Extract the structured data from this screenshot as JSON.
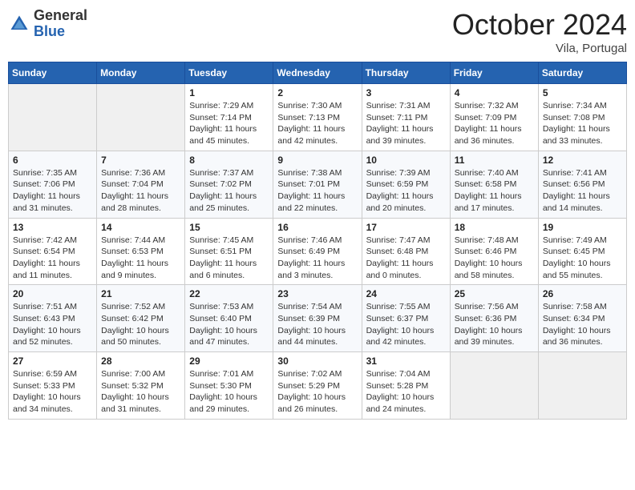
{
  "header": {
    "logo": {
      "general": "General",
      "blue": "Blue"
    },
    "title": "October 2024",
    "location": "Vila, Portugal"
  },
  "weekdays": [
    "Sunday",
    "Monday",
    "Tuesday",
    "Wednesday",
    "Thursday",
    "Friday",
    "Saturday"
  ],
  "weeks": [
    [
      {
        "day": "",
        "info": ""
      },
      {
        "day": "",
        "info": ""
      },
      {
        "day": "1",
        "info": "Sunrise: 7:29 AM\nSunset: 7:14 PM\nDaylight: 11 hours and 45 minutes."
      },
      {
        "day": "2",
        "info": "Sunrise: 7:30 AM\nSunset: 7:13 PM\nDaylight: 11 hours and 42 minutes."
      },
      {
        "day": "3",
        "info": "Sunrise: 7:31 AM\nSunset: 7:11 PM\nDaylight: 11 hours and 39 minutes."
      },
      {
        "day": "4",
        "info": "Sunrise: 7:32 AM\nSunset: 7:09 PM\nDaylight: 11 hours and 36 minutes."
      },
      {
        "day": "5",
        "info": "Sunrise: 7:34 AM\nSunset: 7:08 PM\nDaylight: 11 hours and 33 minutes."
      }
    ],
    [
      {
        "day": "6",
        "info": "Sunrise: 7:35 AM\nSunset: 7:06 PM\nDaylight: 11 hours and 31 minutes."
      },
      {
        "day": "7",
        "info": "Sunrise: 7:36 AM\nSunset: 7:04 PM\nDaylight: 11 hours and 28 minutes."
      },
      {
        "day": "8",
        "info": "Sunrise: 7:37 AM\nSunset: 7:02 PM\nDaylight: 11 hours and 25 minutes."
      },
      {
        "day": "9",
        "info": "Sunrise: 7:38 AM\nSunset: 7:01 PM\nDaylight: 11 hours and 22 minutes."
      },
      {
        "day": "10",
        "info": "Sunrise: 7:39 AM\nSunset: 6:59 PM\nDaylight: 11 hours and 20 minutes."
      },
      {
        "day": "11",
        "info": "Sunrise: 7:40 AM\nSunset: 6:58 PM\nDaylight: 11 hours and 17 minutes."
      },
      {
        "day": "12",
        "info": "Sunrise: 7:41 AM\nSunset: 6:56 PM\nDaylight: 11 hours and 14 minutes."
      }
    ],
    [
      {
        "day": "13",
        "info": "Sunrise: 7:42 AM\nSunset: 6:54 PM\nDaylight: 11 hours and 11 minutes."
      },
      {
        "day": "14",
        "info": "Sunrise: 7:44 AM\nSunset: 6:53 PM\nDaylight: 11 hours and 9 minutes."
      },
      {
        "day": "15",
        "info": "Sunrise: 7:45 AM\nSunset: 6:51 PM\nDaylight: 11 hours and 6 minutes."
      },
      {
        "day": "16",
        "info": "Sunrise: 7:46 AM\nSunset: 6:49 PM\nDaylight: 11 hours and 3 minutes."
      },
      {
        "day": "17",
        "info": "Sunrise: 7:47 AM\nSunset: 6:48 PM\nDaylight: 11 hours and 0 minutes."
      },
      {
        "day": "18",
        "info": "Sunrise: 7:48 AM\nSunset: 6:46 PM\nDaylight: 10 hours and 58 minutes."
      },
      {
        "day": "19",
        "info": "Sunrise: 7:49 AM\nSunset: 6:45 PM\nDaylight: 10 hours and 55 minutes."
      }
    ],
    [
      {
        "day": "20",
        "info": "Sunrise: 7:51 AM\nSunset: 6:43 PM\nDaylight: 10 hours and 52 minutes."
      },
      {
        "day": "21",
        "info": "Sunrise: 7:52 AM\nSunset: 6:42 PM\nDaylight: 10 hours and 50 minutes."
      },
      {
        "day": "22",
        "info": "Sunrise: 7:53 AM\nSunset: 6:40 PM\nDaylight: 10 hours and 47 minutes."
      },
      {
        "day": "23",
        "info": "Sunrise: 7:54 AM\nSunset: 6:39 PM\nDaylight: 10 hours and 44 minutes."
      },
      {
        "day": "24",
        "info": "Sunrise: 7:55 AM\nSunset: 6:37 PM\nDaylight: 10 hours and 42 minutes."
      },
      {
        "day": "25",
        "info": "Sunrise: 7:56 AM\nSunset: 6:36 PM\nDaylight: 10 hours and 39 minutes."
      },
      {
        "day": "26",
        "info": "Sunrise: 7:58 AM\nSunset: 6:34 PM\nDaylight: 10 hours and 36 minutes."
      }
    ],
    [
      {
        "day": "27",
        "info": "Sunrise: 6:59 AM\nSunset: 5:33 PM\nDaylight: 10 hours and 34 minutes."
      },
      {
        "day": "28",
        "info": "Sunrise: 7:00 AM\nSunset: 5:32 PM\nDaylight: 10 hours and 31 minutes."
      },
      {
        "day": "29",
        "info": "Sunrise: 7:01 AM\nSunset: 5:30 PM\nDaylight: 10 hours and 29 minutes."
      },
      {
        "day": "30",
        "info": "Sunrise: 7:02 AM\nSunset: 5:29 PM\nDaylight: 10 hours and 26 minutes."
      },
      {
        "day": "31",
        "info": "Sunrise: 7:04 AM\nSunset: 5:28 PM\nDaylight: 10 hours and 24 minutes."
      },
      {
        "day": "",
        "info": ""
      },
      {
        "day": "",
        "info": ""
      }
    ]
  ]
}
